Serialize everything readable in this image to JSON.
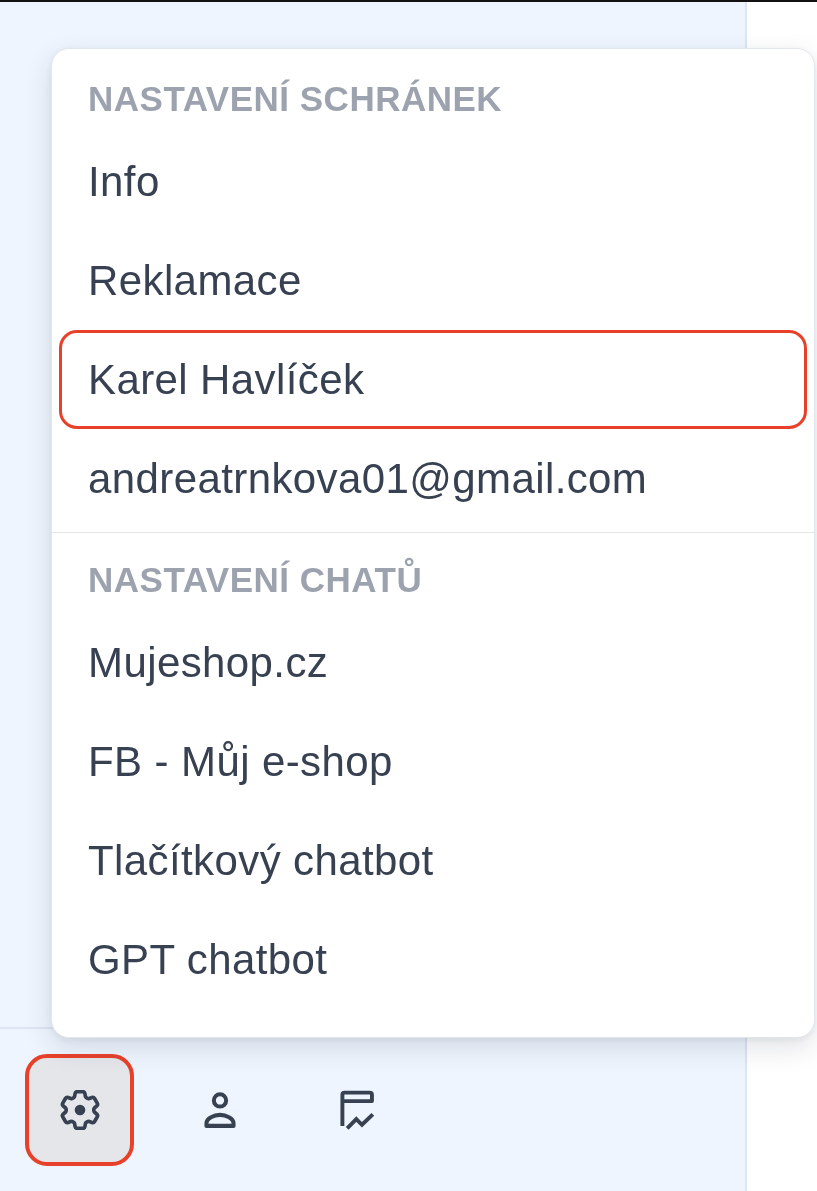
{
  "settings_menu": {
    "sections": [
      {
        "heading": "NASTAVENÍ SCHRÁNEK",
        "items": [
          {
            "label": "Info",
            "highlighted": false
          },
          {
            "label": "Reklamace",
            "highlighted": false
          },
          {
            "label": "Karel Havlíček",
            "highlighted": true
          },
          {
            "label": "andreatrnkova01@gmail.com",
            "highlighted": false
          }
        ]
      },
      {
        "heading": "NASTAVENÍ CHATŮ",
        "items": [
          {
            "label": "Mujeshop.cz",
            "highlighted": false
          },
          {
            "label": "FB - Můj e-shop",
            "highlighted": false
          },
          {
            "label": "Tlačítkový chatbot",
            "highlighted": false
          },
          {
            "label": "GPT chatbot",
            "highlighted": false
          }
        ]
      }
    ]
  },
  "footer": {
    "buttons": [
      {
        "kind": "settings",
        "selected": true,
        "highlighted": true
      },
      {
        "kind": "account",
        "selected": false,
        "highlighted": false
      },
      {
        "kind": "analytics",
        "selected": false,
        "highlighted": false
      }
    ]
  }
}
